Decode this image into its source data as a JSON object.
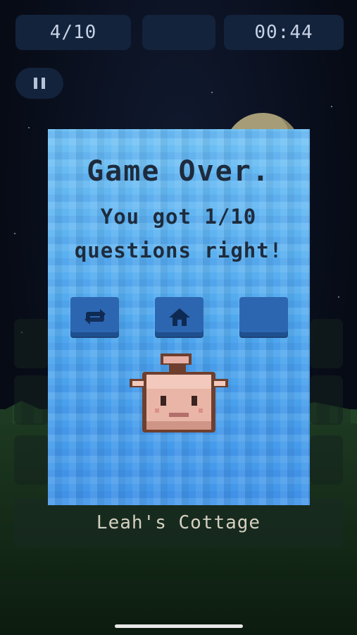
{
  "hud": {
    "progress": "4/10",
    "timer": "00:44"
  },
  "result": {
    "title": "Game Over.",
    "line1": "You got 1/10",
    "line2": "questions right!",
    "score": 1,
    "total": 10
  },
  "location": "Leah's Cottage",
  "icons": {
    "retry": "retry-icon",
    "home": "home-icon",
    "pause": "pause-icon",
    "character": "pufferfish-sprite"
  },
  "colors": {
    "modal_blue": "#5db2ef",
    "button_blue": "#2d66b0",
    "hud_bg": "#13233c",
    "text_dark": "#1e2b3c"
  }
}
